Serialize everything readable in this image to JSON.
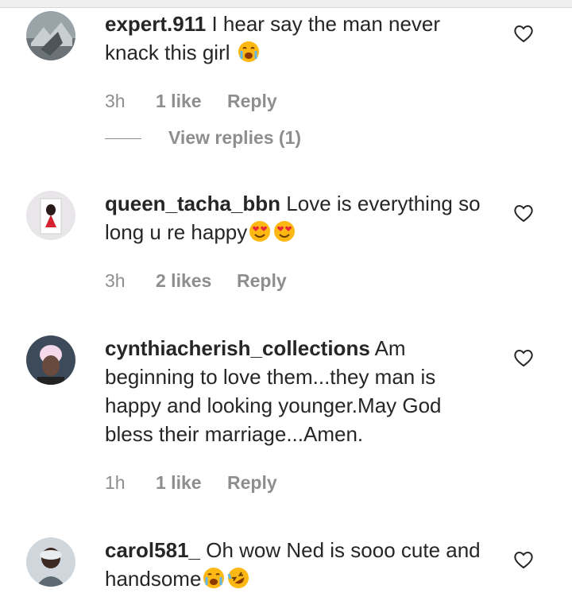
{
  "comments": [
    {
      "username": "expert.911",
      "text": "I hear say the man never knack this girl",
      "emojis": [
        "crying-face"
      ],
      "time": "3h",
      "likes": "1 like",
      "reply_label": "Reply",
      "view_replies": "View replies (1)"
    },
    {
      "username": "queen_tacha_bbn",
      "text": "Love is everything so long u re happy",
      "emojis": [
        "heart-eyes-face",
        "heart-eyes-face"
      ],
      "time": "3h",
      "likes": "2 likes",
      "reply_label": "Reply"
    },
    {
      "username": "cynthiacherish_collections",
      "text": "Am beginning to love them...they man is happy and looking younger.May God bless their marriage...Amen.",
      "emojis": [],
      "time": "1h",
      "likes": "1 like",
      "reply_label": "Reply"
    },
    {
      "username": "carol581_",
      "text": "Oh wow Ned is sooo cute and handsome",
      "emojis": [
        "crying-face",
        "rolling-laughing-face"
      ],
      "time": "",
      "likes": "",
      "reply_label": ""
    }
  ],
  "icons": {
    "like": "heart-outline-icon"
  },
  "colors": {
    "text": "#262626",
    "meta": "#8e8e8e",
    "emoji": "#fdb813"
  }
}
